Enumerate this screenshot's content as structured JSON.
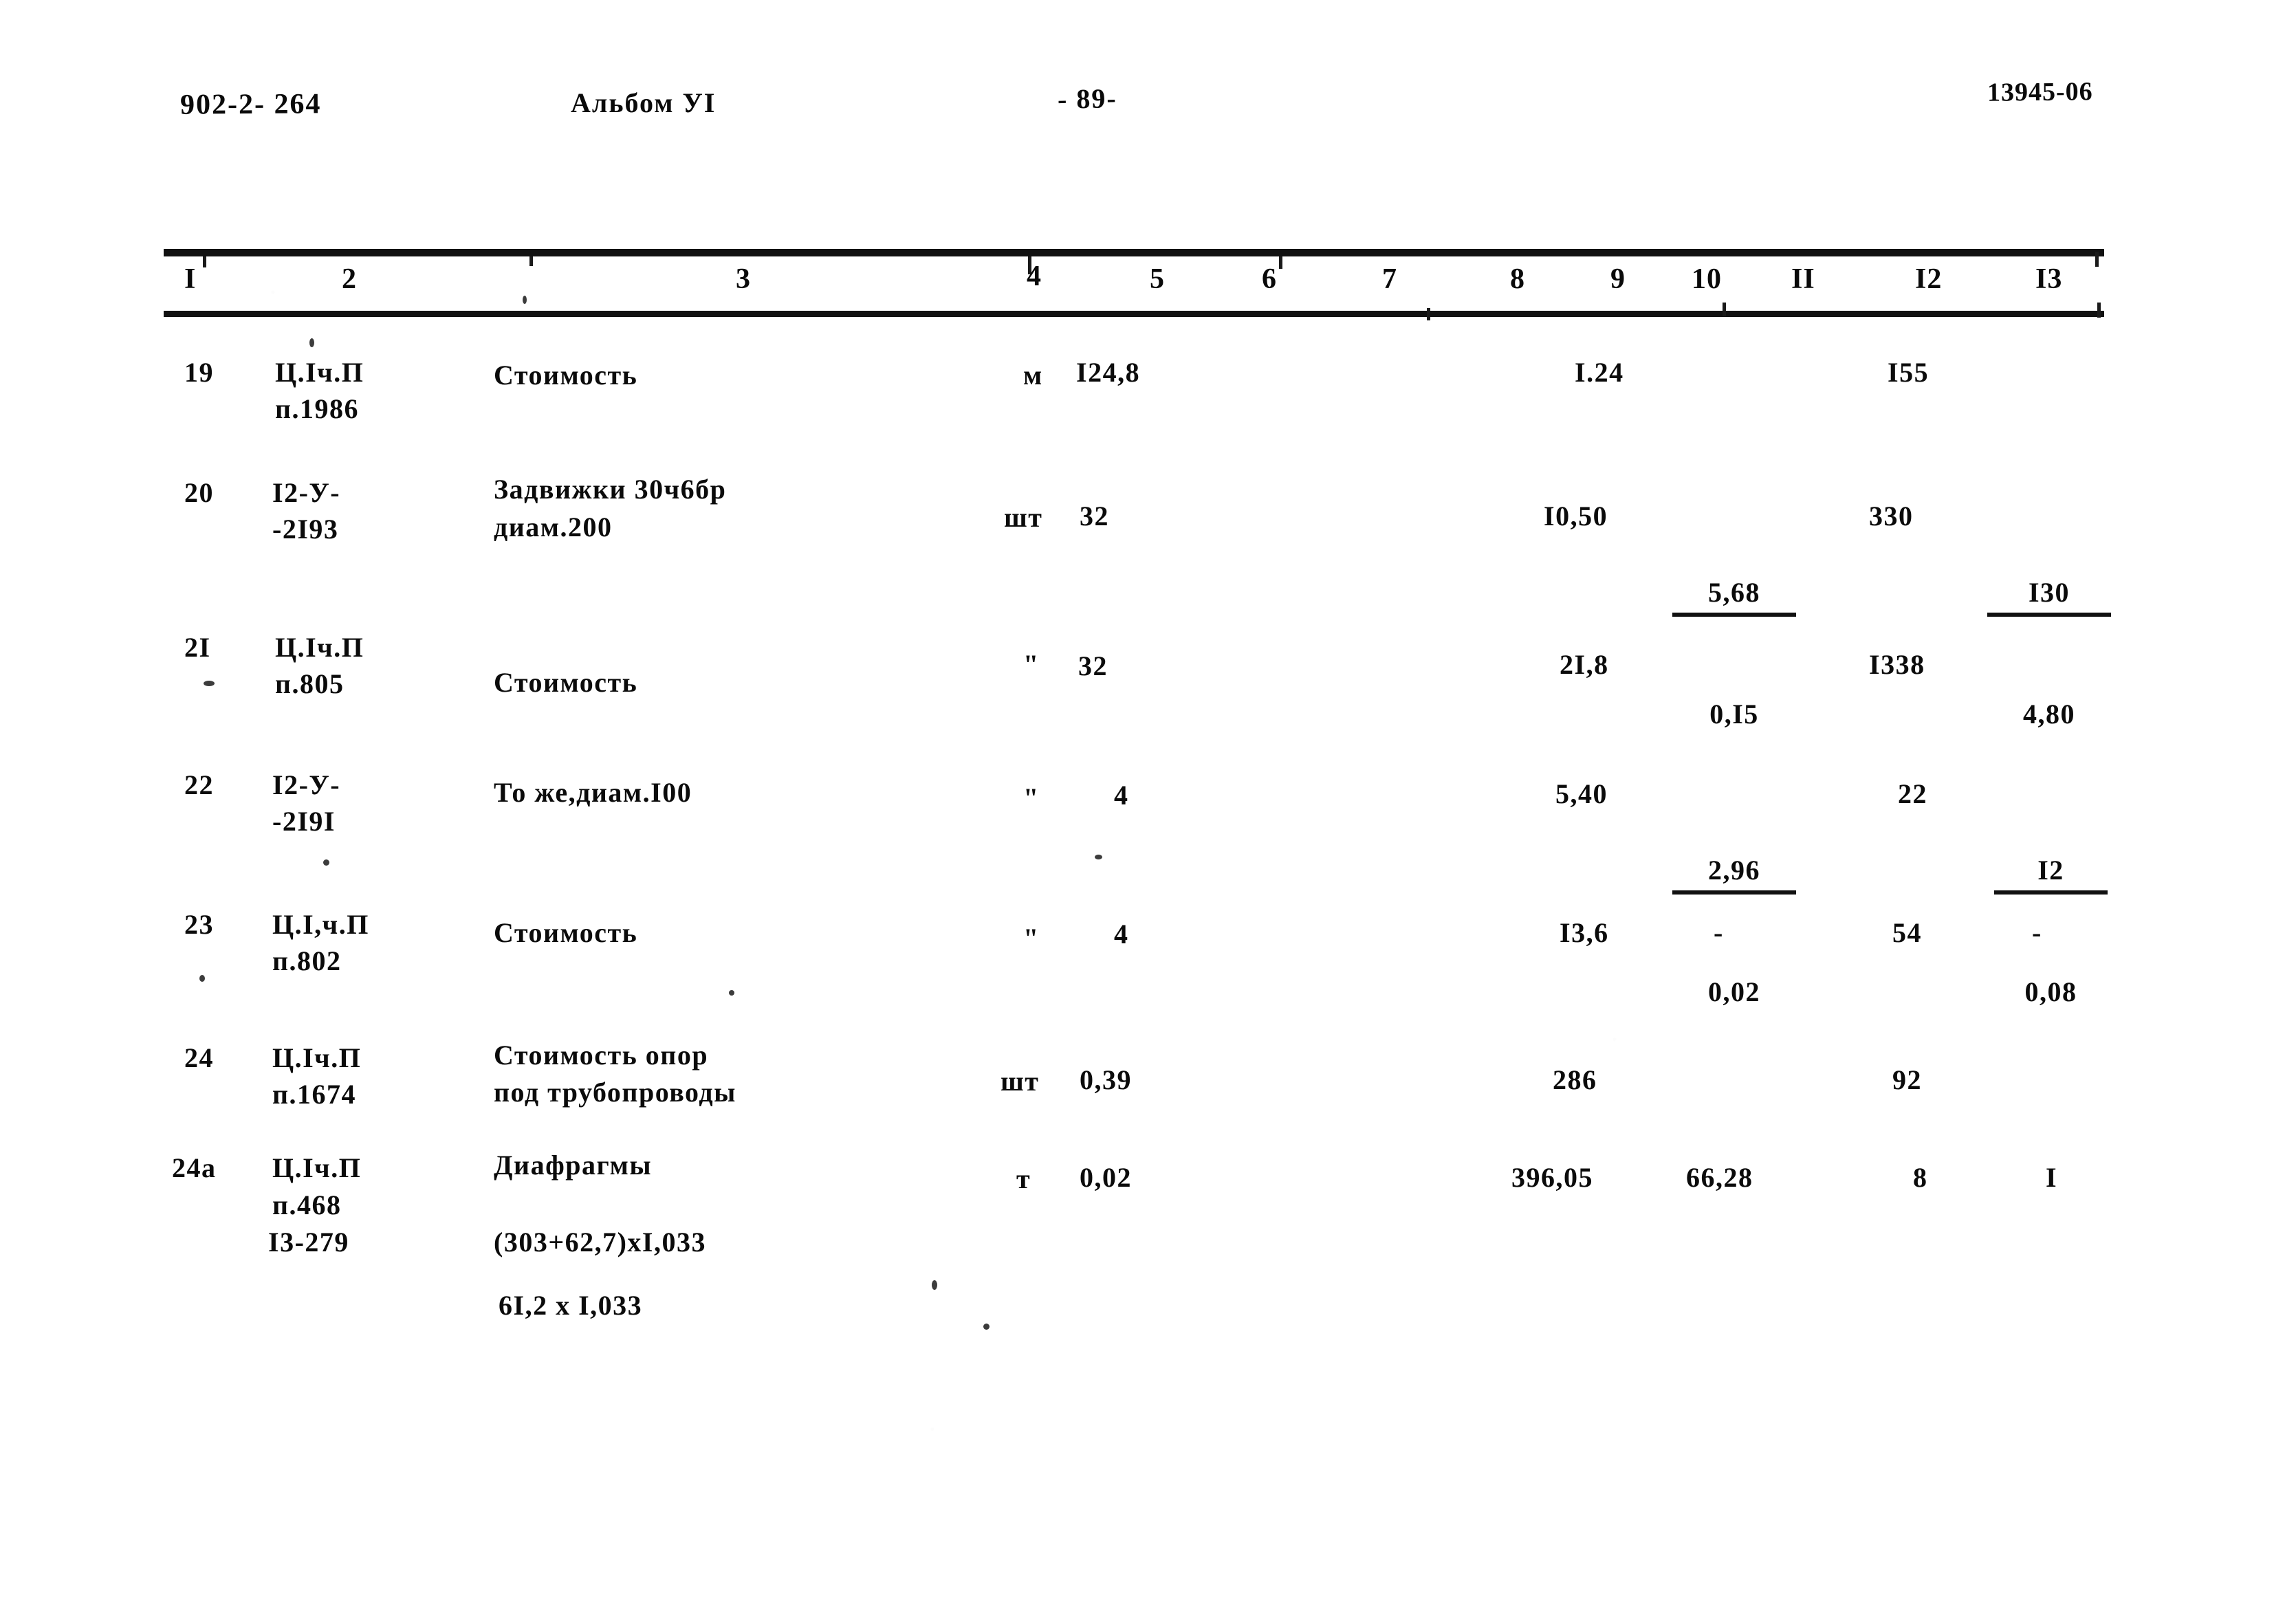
{
  "header": {
    "doc_code": "902-2- 264",
    "album": "Альбом УI",
    "page_number": "- 89-",
    "archive_stamp": "13945-06"
  },
  "table": {
    "column_numbers": [
      "I",
      "2",
      "3",
      "4",
      "5",
      "6",
      "7",
      "8",
      "9",
      "10",
      "II",
      "I2",
      "I3"
    ],
    "rows": [
      {
        "num": "19",
        "code": "Ц.Iч.П",
        "code2": "п.1986",
        "code3": "",
        "name": "Стоимость",
        "name2": "",
        "name3": "",
        "unit": "м",
        "qty": "I24,8",
        "c9": "I.24",
        "c10": "",
        "c10_num": "",
        "c10_den": "",
        "c12": "I55",
        "c13": "",
        "c13_num": "",
        "c13_den": ""
      },
      {
        "num": "20",
        "code": "I2-У-",
        "code2": "-2I93",
        "code3": "",
        "name": "Задвижки 30ч6бр",
        "name2": "диам.200",
        "name3": "",
        "unit": "шт",
        "qty": "32",
        "c9": "I0,50",
        "c10": "",
        "c10_num": "5,68",
        "c10_den": "0,I5",
        "c12": "330",
        "c13": "",
        "c13_num": "I30",
        "c13_den": "4,80"
      },
      {
        "num": "2I",
        "code": "Ц.Iч.П",
        "code2": "п.805",
        "code3": "",
        "name": "Стоимость",
        "name2": "",
        "name3": "",
        "unit": "\"",
        "qty": "32",
        "c9": "2I,8",
        "c10": "",
        "c10_num": "",
        "c10_den": "",
        "c12": "I338",
        "c13": "",
        "c13_num": "",
        "c13_den": ""
      },
      {
        "num": "22",
        "code": "I2-У-",
        "code2": "-2I9I",
        "code3": "",
        "name": "То же,диам.I00",
        "name2": "",
        "name3": "",
        "unit": "\"",
        "qty": "4",
        "c9": "5,40",
        "c10": "",
        "c10_num": "2,96",
        "c10_den": "0,02",
        "c12": "22",
        "c13": "",
        "c13_num": "I2",
        "c13_den": "0,08"
      },
      {
        "num": "23",
        "code": "Ц.I,ч.П",
        "code2": "п.802",
        "code3": "",
        "name": "Стоимость",
        "name2": "",
        "name3": "",
        "unit": "\"",
        "qty": "4",
        "c9": "I3,6",
        "c10": "-",
        "c10_num": "",
        "c10_den": "",
        "c12": "54",
        "c13": "-",
        "c13_num": "",
        "c13_den": ""
      },
      {
        "num": "24",
        "code": "Ц.Iч.П",
        "code2": "п.1674",
        "code3": "",
        "name": "Стоимость опор",
        "name2": "под трубопроводы",
        "name3": "",
        "unit": "шт",
        "qty": "0,39",
        "c9": "286",
        "c10": "",
        "c10_num": "",
        "c10_den": "",
        "c12": "92",
        "c13": "",
        "c13_num": "",
        "c13_den": ""
      },
      {
        "num": "24а",
        "code": "Ц.Iч.П",
        "code2": "п.468",
        "code3": "I3-279",
        "name": "Диафрагмы",
        "name2": "(303+62,7)хI,033",
        "name3": "6I,2 х I,033",
        "unit": "т",
        "qty": "0,02",
        "c9": "396,05",
        "c10": "66,28",
        "c10_num": "",
        "c10_den": "",
        "c12": "8",
        "c13": "I",
        "c13_num": "",
        "c13_den": ""
      }
    ]
  }
}
